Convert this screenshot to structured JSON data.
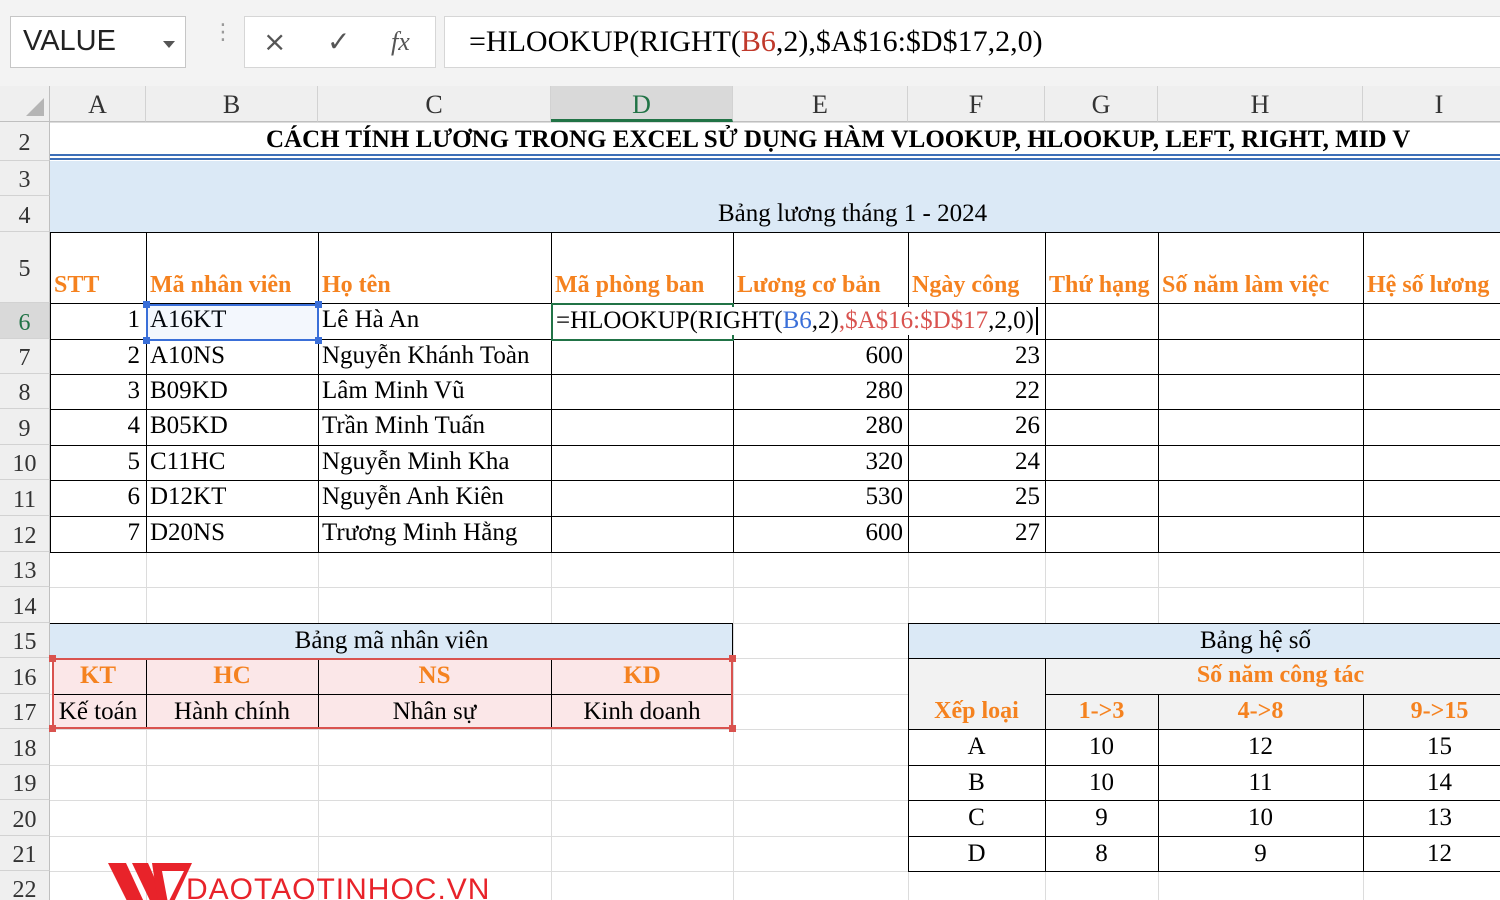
{
  "formula_bar": {
    "name_box": "VALUE",
    "cancel_icon": "×",
    "enter_icon": "✓",
    "fx_label": "fx",
    "formula_parts": [
      {
        "text": "=HLOOKUP(RIGHT(",
        "color": "#000000"
      },
      {
        "text": "B6",
        "color": "#c0392b"
      },
      {
        "text": ",2)",
        "color": "#000000"
      },
      {
        "text": ",$A$16:$D$17",
        "color": "#000000"
      },
      {
        "text": ",2,0)",
        "color": "#000000"
      }
    ]
  },
  "columns": [
    "A",
    "B",
    "C",
    "D",
    "E",
    "F",
    "G",
    "H",
    "I"
  ],
  "rows": [
    "2",
    "3",
    "4",
    "5",
    "6",
    "7",
    "8",
    "9",
    "10",
    "11",
    "12",
    "13",
    "14",
    "15",
    "16",
    "17",
    "18",
    "19",
    "20",
    "21",
    "22"
  ],
  "sheet": {
    "title": "CÁCH TÍNH LƯƠNG TRONG EXCEL SỬ DỤNG HÀM VLOOKUP, HLOOKUP, LEFT, RIGHT, MID V",
    "subtitle": "Bảng lương tháng 1 - 2024",
    "headers": [
      "STT",
      "Mã nhân viên",
      "Họ tên",
      "Mã phòng ban",
      "Lương cơ bản",
      "Ngày công",
      "Thứ hạng",
      "Số năm làm việc",
      "Hệ số lương"
    ],
    "editing_formula": [
      {
        "text": "=HLOOKUP(RIGHT(",
        "color": "#000000"
      },
      {
        "text": "B6",
        "color": "#3a6fd8"
      },
      {
        "text": ",2)",
        "color": "#000000"
      },
      {
        "text": ",$A$16:$D$17",
        "color": "#d9534f"
      },
      {
        "text": ",2,0)",
        "color": "#000000"
      }
    ],
    "employees": [
      {
        "stt": "1",
        "code": "A16KT",
        "name": "Lê Hà An",
        "salary": "",
        "days": ""
      },
      {
        "stt": "2",
        "code": "A10NS",
        "name": "Nguyễn Khánh Toàn",
        "salary": "600",
        "days": "23"
      },
      {
        "stt": "3",
        "code": "B09KD",
        "name": "Lâm Minh Vũ",
        "salary": "280",
        "days": "22"
      },
      {
        "stt": "4",
        "code": "B05KD",
        "name": "Trần Minh Tuấn",
        "salary": "280",
        "days": "26"
      },
      {
        "stt": "5",
        "code": "C11HC",
        "name": "Nguyễn Minh Kha",
        "salary": "320",
        "days": "24"
      },
      {
        "stt": "6",
        "code": "D12KT",
        "name": "Nguyễn Anh Kiên",
        "salary": "530",
        "days": "25"
      },
      {
        "stt": "7",
        "code": "D20NS",
        "name": "Trương Minh Hằng",
        "salary": "600",
        "days": "27"
      }
    ],
    "dept_table": {
      "title": "Bảng mã nhân viên",
      "codes": [
        "KT",
        "HC",
        "NS",
        "KD"
      ],
      "names": [
        "Kế toán",
        "Hành chính",
        "Nhân sự",
        "Kinh doanh"
      ]
    },
    "coef_table": {
      "title": "Bảng hệ số",
      "group_label": "Số năm công tác",
      "rank_label": "Xếp loại",
      "ranges": [
        "1->3",
        "4->8",
        "9->15"
      ],
      "rows": [
        {
          "rank": "A",
          "values": [
            "10",
            "12",
            "15"
          ]
        },
        {
          "rank": "B",
          "values": [
            "10",
            "11",
            "14"
          ]
        },
        {
          "rank": "C",
          "values": [
            "9",
            "10",
            "13"
          ]
        },
        {
          "rank": "D",
          "values": [
            "8",
            "9",
            "12"
          ]
        }
      ]
    }
  },
  "logo": {
    "text": "DAOTAOTINHOC.VN",
    "color": "#e8232a"
  }
}
